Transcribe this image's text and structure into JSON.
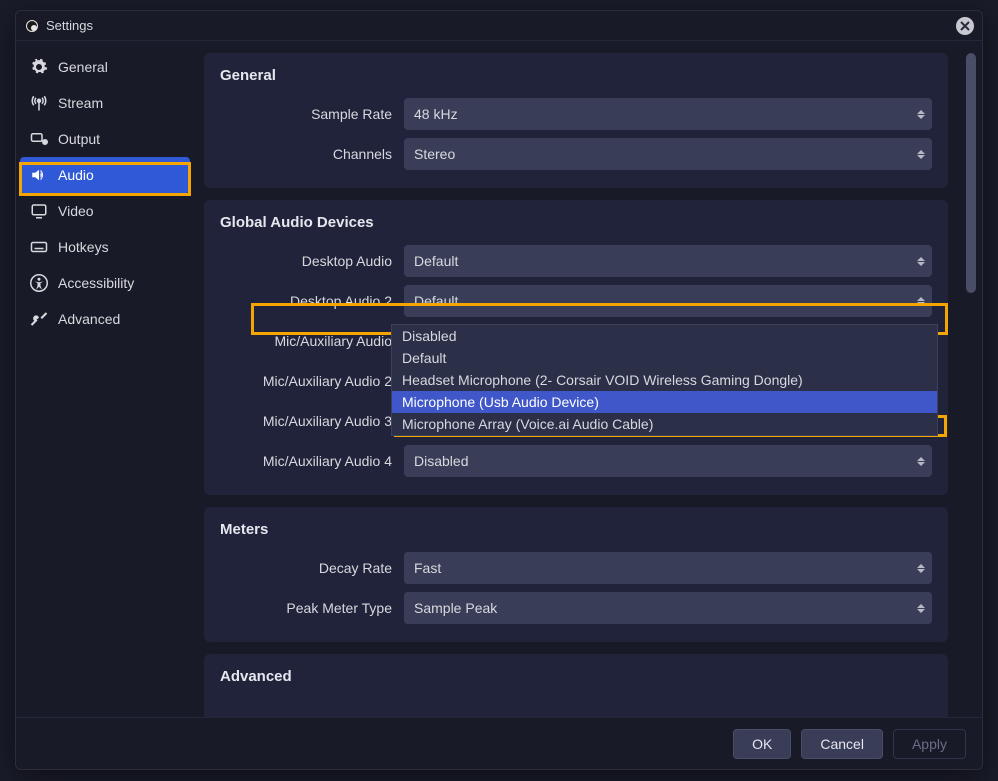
{
  "titlebar": {
    "title": "Settings"
  },
  "sidebar": {
    "items": [
      {
        "label": "General",
        "icon": "gear-icon"
      },
      {
        "label": "Stream",
        "icon": "antenna-icon"
      },
      {
        "label": "Output",
        "icon": "output-icon"
      },
      {
        "label": "Audio",
        "icon": "speaker-icon",
        "active": true
      },
      {
        "label": "Video",
        "icon": "monitor-icon"
      },
      {
        "label": "Hotkeys",
        "icon": "keyboard-icon"
      },
      {
        "label": "Accessibility",
        "icon": "accessibility-icon"
      },
      {
        "label": "Advanced",
        "icon": "tools-icon"
      }
    ]
  },
  "sections": {
    "general": {
      "title": "General",
      "sample_rate": {
        "label": "Sample Rate",
        "value": "48 kHz"
      },
      "channels": {
        "label": "Channels",
        "value": "Stereo"
      }
    },
    "global_audio": {
      "title": "Global Audio Devices",
      "desktop": {
        "label": "Desktop Audio",
        "value": "Default"
      },
      "desktop2": {
        "label": "Desktop Audio 2",
        "value": "Default"
      },
      "mic": {
        "label": "Mic/Auxiliary Audio",
        "value": "Microphone (Usb Audio Device)"
      },
      "mic2": {
        "label": "Mic/Auxiliary Audio 2"
      },
      "mic3": {
        "label": "Mic/Auxiliary Audio 3"
      },
      "mic4": {
        "label": "Mic/Auxiliary Audio 4",
        "value": "Disabled"
      },
      "mic_options": [
        "Disabled",
        "Default",
        "Headset Microphone (2- Corsair VOID Wireless Gaming Dongle)",
        "Microphone (Usb Audio Device)",
        "Microphone Array (Voice.ai Audio Cable)"
      ],
      "mic_selected_index": 3
    },
    "meters": {
      "title": "Meters",
      "decay": {
        "label": "Decay Rate",
        "value": "Fast"
      },
      "peak": {
        "label": "Peak Meter Type",
        "value": "Sample Peak"
      }
    },
    "advanced": {
      "title": "Advanced"
    }
  },
  "footer": {
    "ok": "OK",
    "cancel": "Cancel",
    "apply": "Apply"
  }
}
